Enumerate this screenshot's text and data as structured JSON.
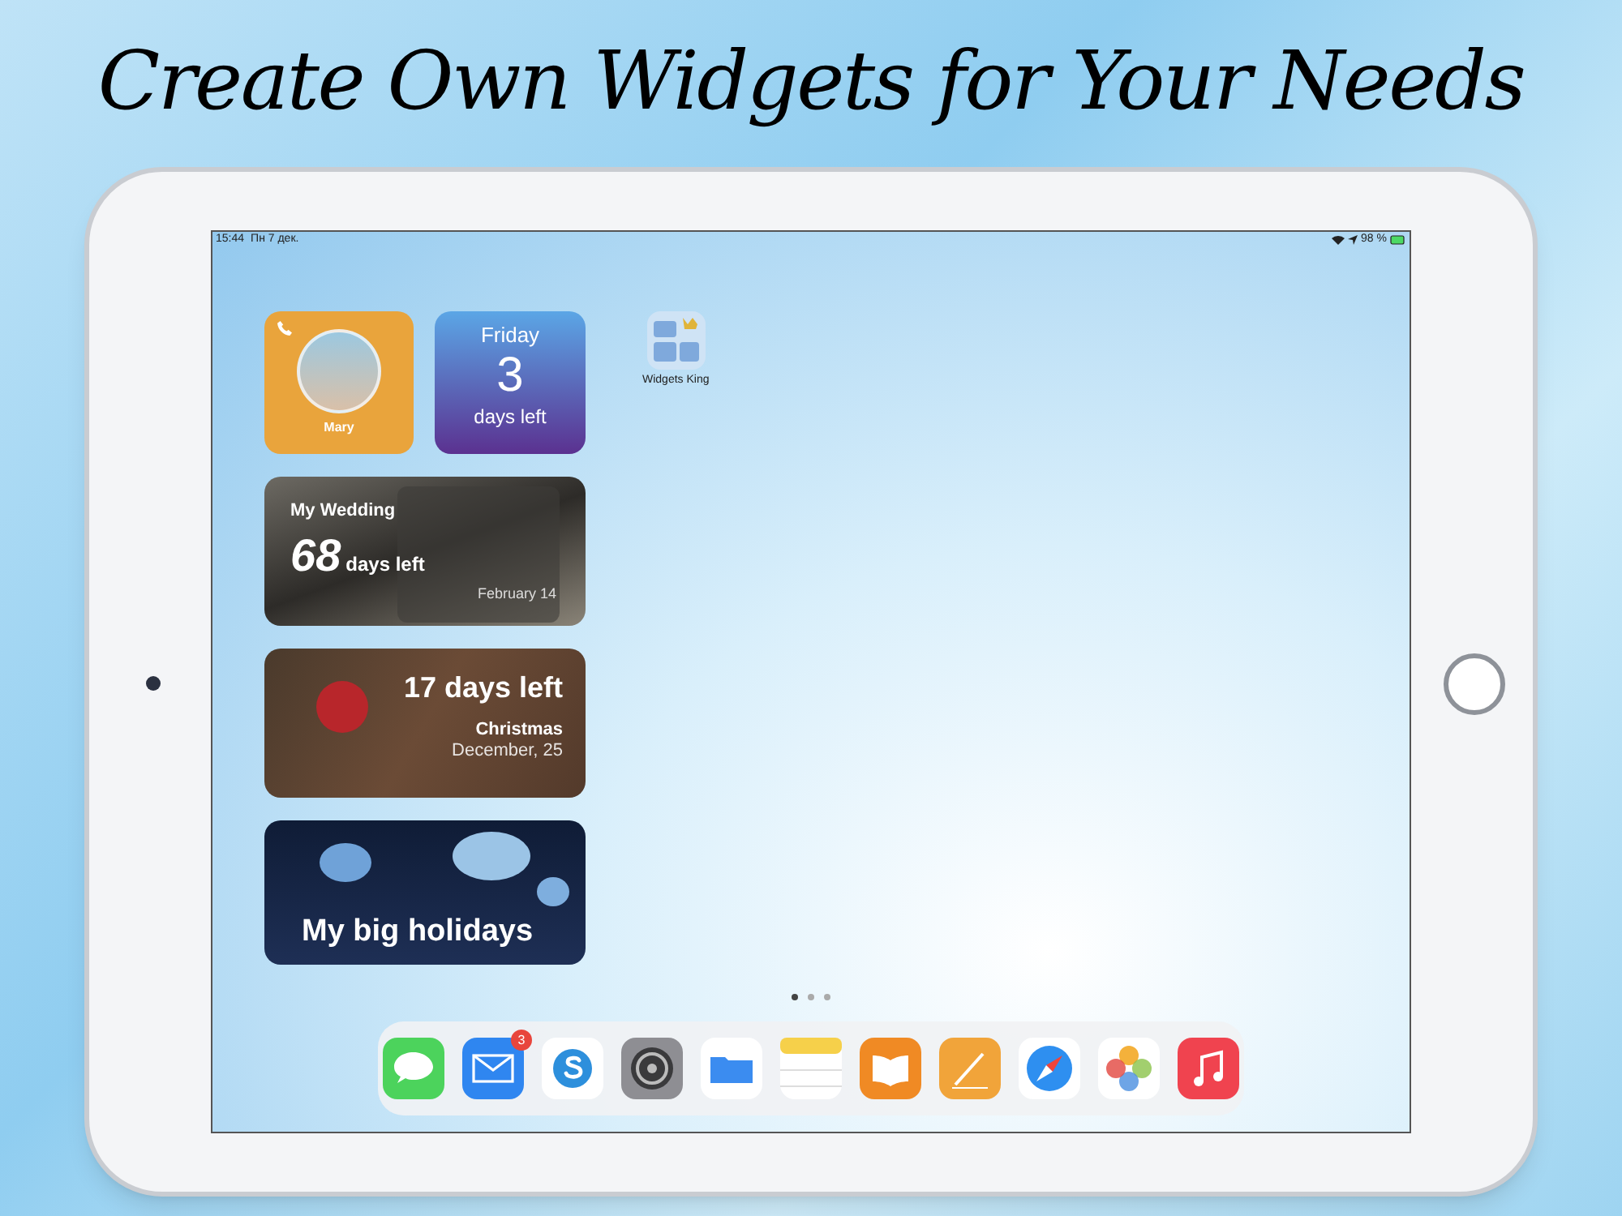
{
  "headline": "Create Own Widgets for Your Needs",
  "status_bar": {
    "time": "15:44",
    "date": "Пн 7 дек.",
    "battery": "98 %"
  },
  "widgets": [
    {
      "kind": "contact",
      "name": "Mary"
    },
    {
      "kind": "countdown",
      "day": "Friday",
      "count": "3",
      "caption": "days left"
    },
    {
      "kind": "event_photo",
      "title": "My Wedding",
      "count": "68",
      "caption": "days left",
      "date": "February 14"
    },
    {
      "kind": "event_card",
      "headline": "17 days left",
      "title": "Christmas",
      "date": "December, 25"
    },
    {
      "kind": "banner",
      "title": "My big holidays"
    }
  ],
  "app_icons": [
    {
      "label": "Widgets King"
    }
  ],
  "page_dots": [
    {
      "selected": true
    },
    {
      "selected": false
    },
    {
      "selected": false
    }
  ],
  "dock": [
    {
      "kind": "messages"
    },
    {
      "kind": "mail",
      "badge": "3"
    },
    {
      "kind": "skype"
    },
    {
      "kind": "settings"
    },
    {
      "kind": "files"
    },
    {
      "kind": "notes"
    },
    {
      "kind": "books"
    },
    {
      "kind": "pages"
    },
    {
      "kind": "safari"
    },
    {
      "kind": "photos"
    },
    {
      "kind": "music"
    }
  ]
}
